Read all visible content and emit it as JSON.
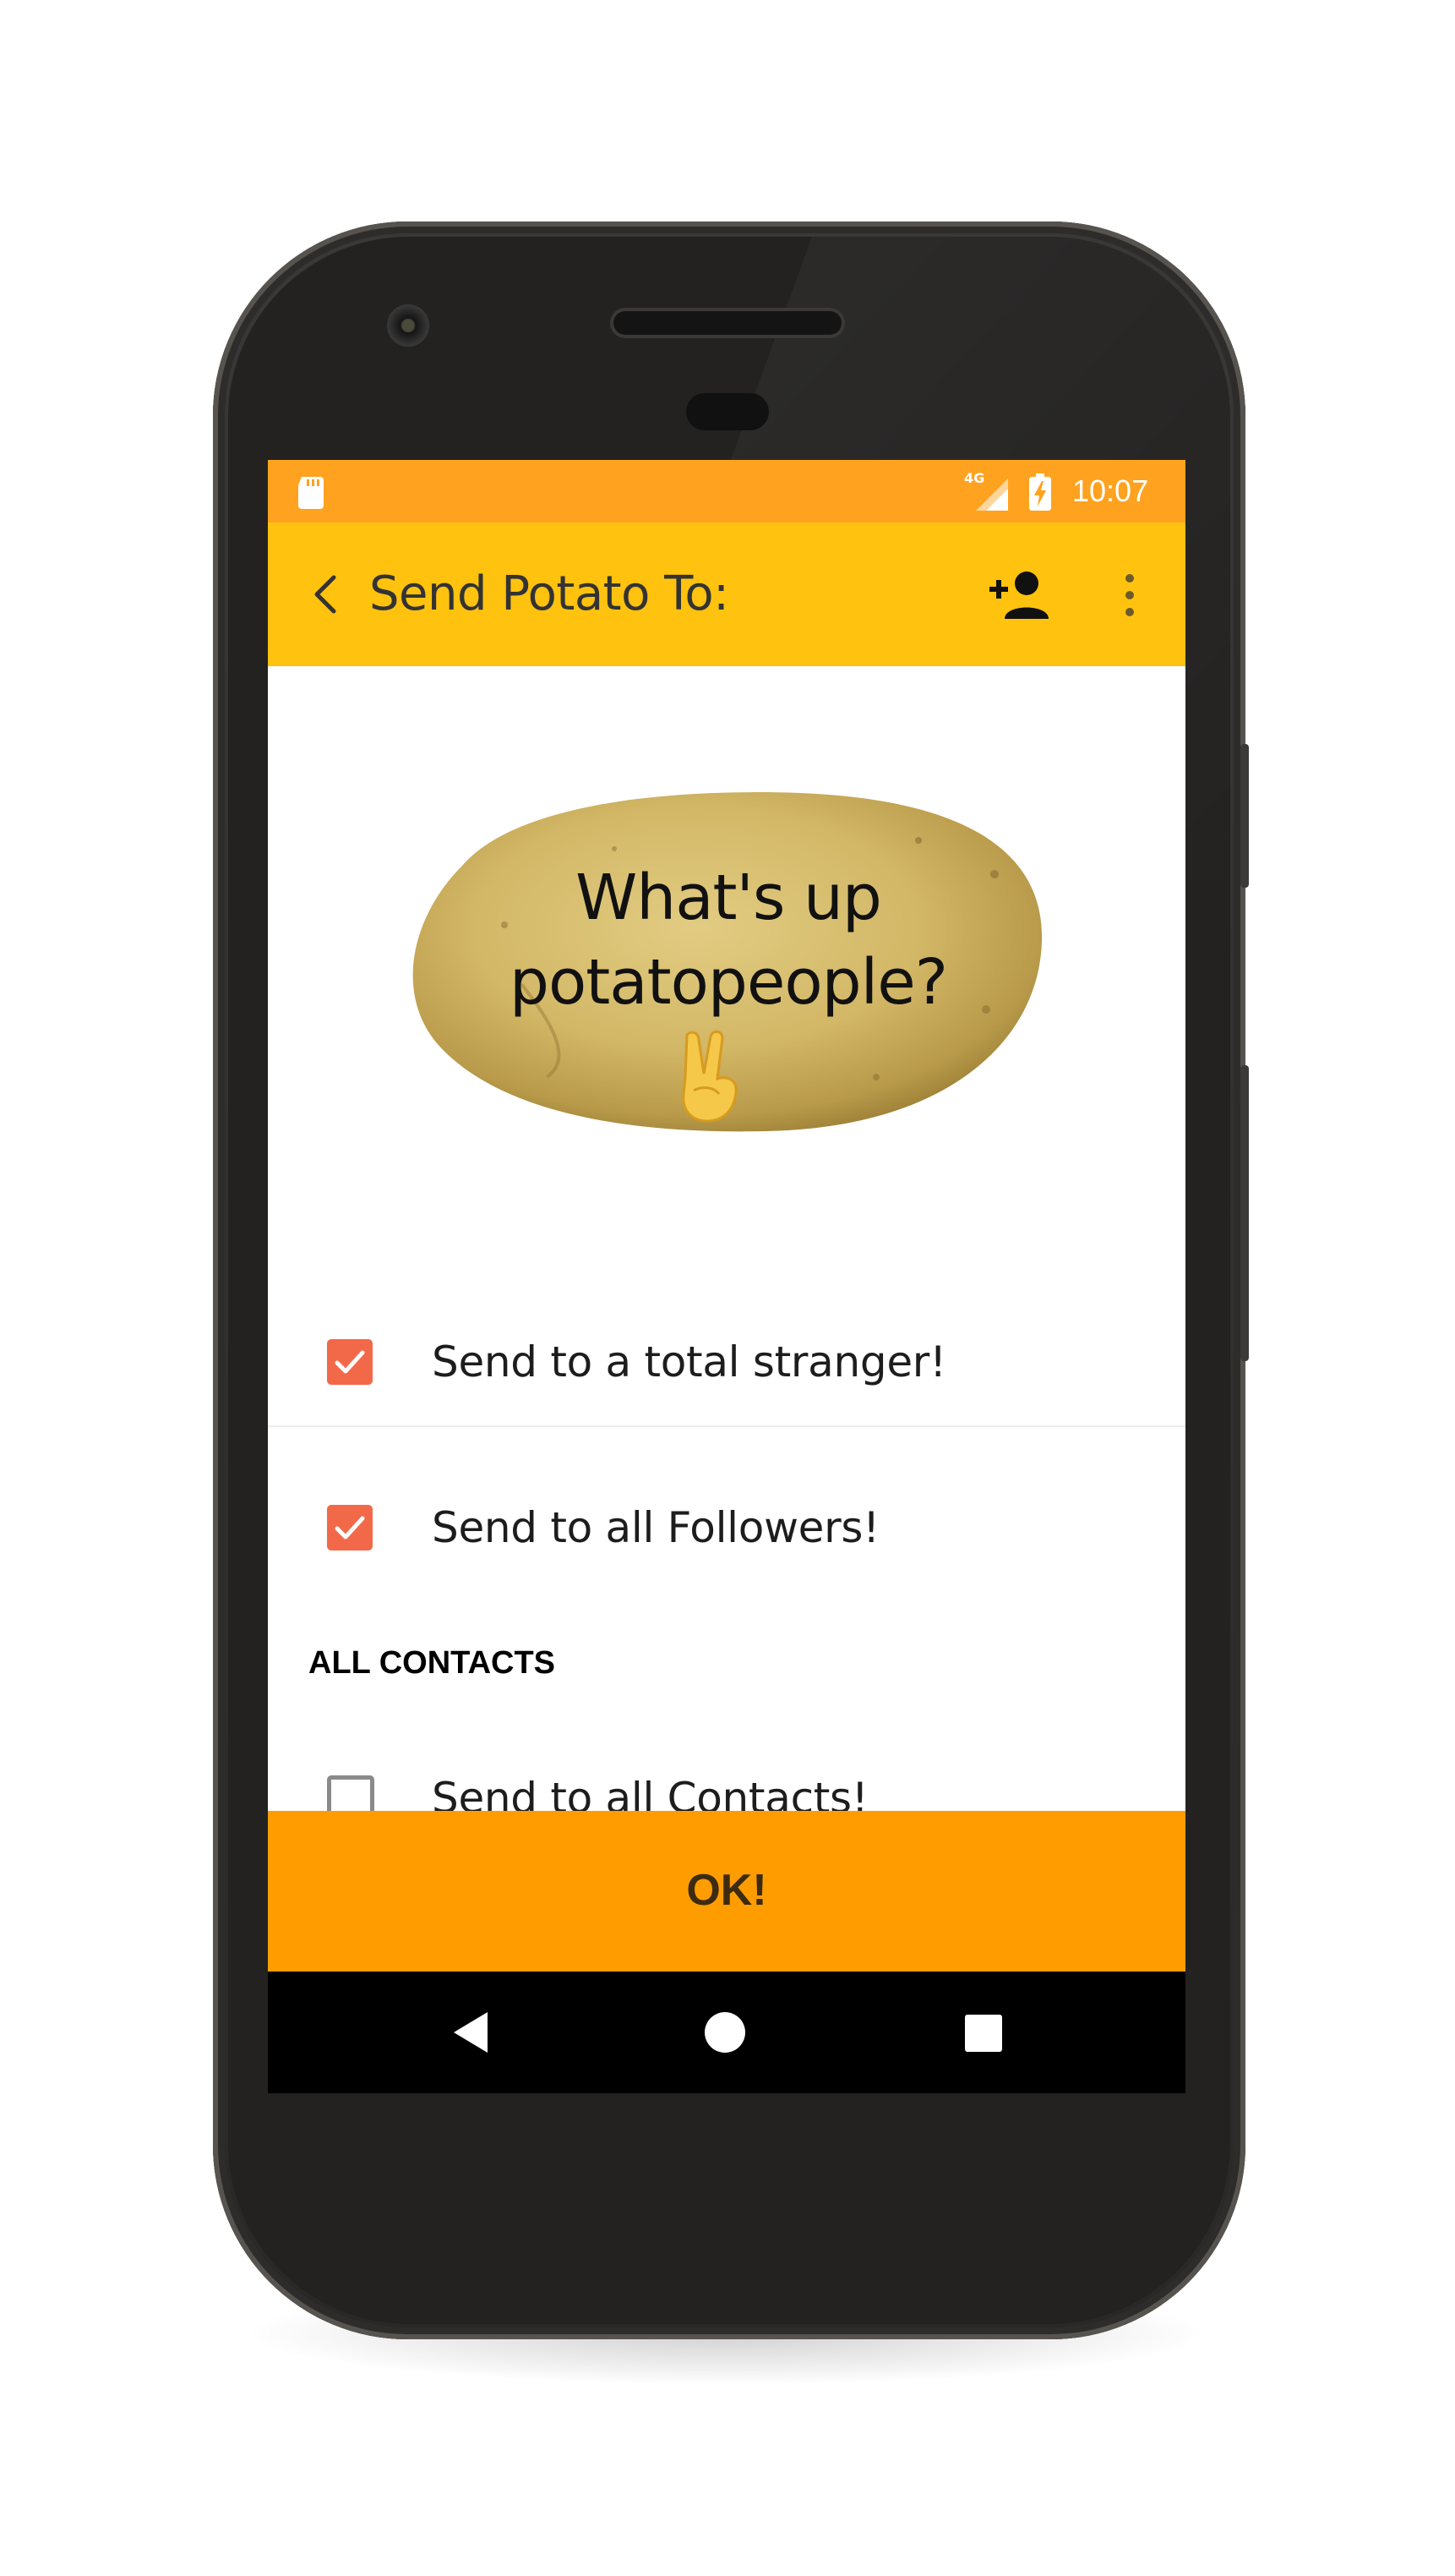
{
  "status_bar": {
    "network": "4G",
    "time": "10:07",
    "icons": [
      "sd-card-icon",
      "signal-icon",
      "battery-charging-icon"
    ]
  },
  "toolbar": {
    "title": "Send Potato To:",
    "icons": [
      "back-chevron-icon",
      "add-person-icon",
      "overflow-menu-icon"
    ]
  },
  "potato": {
    "message_line1": "What's up",
    "message_line2": "potatopeople?",
    "emoji": "✌"
  },
  "options": [
    {
      "label": "Send to a total stranger!",
      "checked": true
    },
    {
      "label": "Send to all Followers!",
      "checked": true
    }
  ],
  "contacts": {
    "header": "ALL CONTACTS",
    "items": [
      {
        "label": "Send to all Contacts!",
        "checked": false
      }
    ]
  },
  "ok_button": {
    "label": "OK!"
  },
  "nav_bar": {
    "icons": [
      "nav-back-icon",
      "nav-home-icon",
      "nav-recents-icon"
    ]
  },
  "colors": {
    "status_bar": "#ffa21f",
    "toolbar": "#ffc20e",
    "checkbox": "#f2694a",
    "ok_button": "#ff9d00",
    "nav_bar": "#000000"
  }
}
